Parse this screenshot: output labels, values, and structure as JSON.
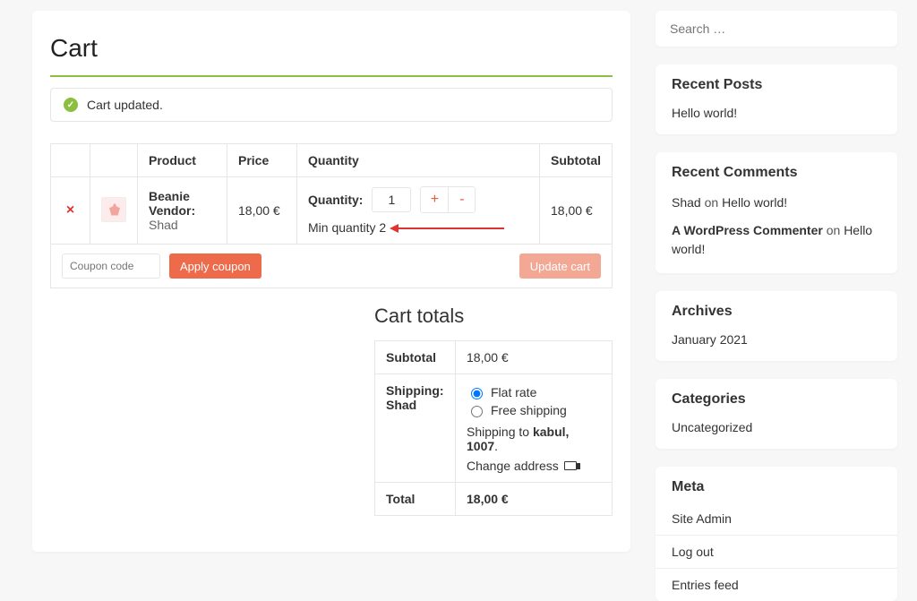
{
  "cart": {
    "title": "Cart",
    "alert": "Cart updated.",
    "thead": {
      "product": "Product",
      "price": "Price",
      "quantity": "Quantity",
      "subtotal": "Subtotal"
    },
    "items": [
      {
        "name": "Beanie",
        "vendor_label": "Vendor:",
        "vendor": "Shad",
        "price": "18,00 €",
        "qty_label": "Quantity:",
        "qty": "1",
        "min_msg": "Min quantity 2",
        "subtotal": "18,00 €"
      }
    ],
    "coupon_placeholder": "Coupon code",
    "apply_coupon_btn": "Apply coupon",
    "update_cart_btn": "Update cart",
    "totals": {
      "title": "Cart totals",
      "subtotal_label": "Subtotal",
      "subtotal": "18,00 €",
      "shipping_label": "Shipping: Shad",
      "flat_rate": "Flat rate",
      "free_shipping": "Free shipping",
      "shipping_to_prefix": "Shipping to ",
      "shipping_to_loc": "kabul, 1007",
      "shipping_to_suffix": ".",
      "change_address": "Change address",
      "total_label": "Total",
      "total": "18,00 €"
    }
  },
  "sidebar": {
    "search_placeholder": "Search …",
    "recent_posts": {
      "title": "Recent Posts",
      "items": [
        "Hello world!"
      ]
    },
    "recent_comments": {
      "title": "Recent Comments",
      "items": [
        {
          "author": "Shad",
          "on": " on ",
          "post": "Hello world!"
        },
        {
          "author": "A WordPress Commenter",
          "on": " on ",
          "post": "Hello world!"
        }
      ]
    },
    "archives": {
      "title": "Archives",
      "items": [
        "January 2021"
      ]
    },
    "categories": {
      "title": "Categories",
      "items": [
        "Uncategorized"
      ]
    },
    "meta": {
      "title": "Meta",
      "items": [
        "Site Admin",
        "Log out",
        "Entries feed"
      ]
    }
  }
}
